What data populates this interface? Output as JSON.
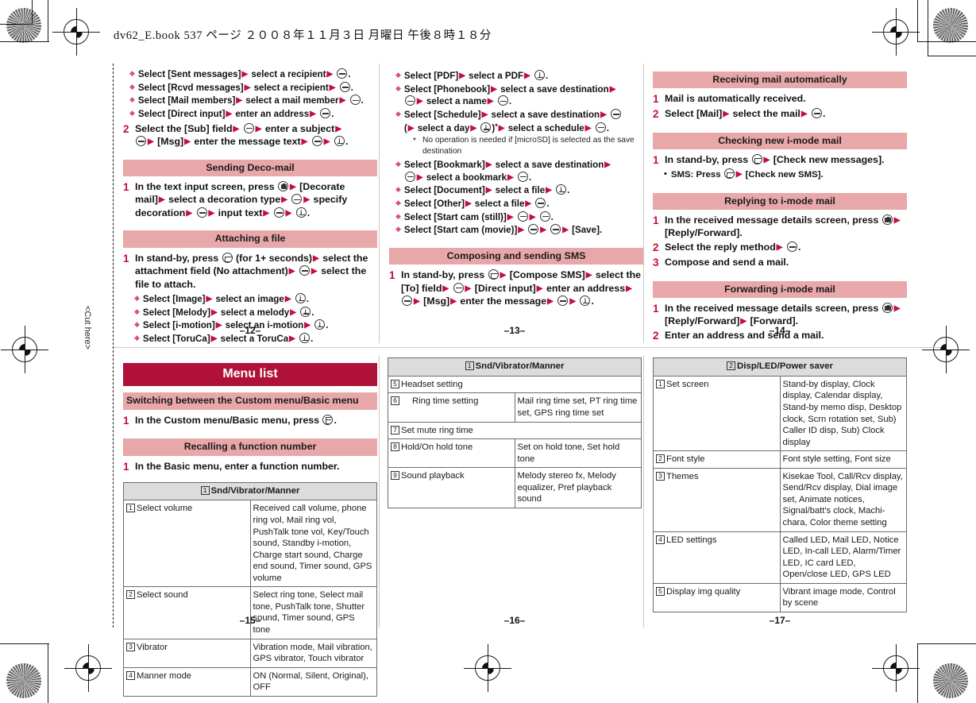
{
  "file_header": "dv62_E.book   537 ページ   ２００８年１１月３日   月曜日   午後８時１８分",
  "cut_here": "<Cut here>",
  "page_numbers": {
    "p12": "–12–",
    "p13": "–13–",
    "p14": "–14–",
    "p15": "–15–",
    "p16": "–16–",
    "p17": "–17–"
  },
  "colors": {
    "section_bar": "#e8a7a9",
    "title_bar": "#b01138",
    "step_number": "#c2103c",
    "arrow": "#c2103c",
    "diamond": "#d4566b",
    "table_header": "#dcdcdc"
  },
  "panel_12": {
    "bullets_top": [
      {
        "pre": "Select [Sent messages]",
        "mid": "select a recipient",
        "keys": [
          "center"
        ],
        "tail": "."
      },
      {
        "pre": "Select [Rcvd messages]",
        "mid": "select a recipient",
        "keys": [
          "center"
        ],
        "tail": "."
      },
      {
        "pre": "Select [Mail members]",
        "mid": "select a mail member",
        "keys": [
          "center"
        ],
        "tail": "."
      },
      {
        "pre": "Select [Direct input]",
        "mid": "enter an address",
        "keys": [
          "center"
        ],
        "tail": "."
      }
    ],
    "step2": "Select the [Sub] field ▶ ⊖ ▶ enter a subject ▶ ⊖ ▶ [Msg] ▶ enter the message text ▶ ⊖ ▶ ⓘ.",
    "sec_deco": "Sending Deco-mail",
    "deco_step1": "In the text input screen, press ⌧ ▶ [Decorate mail] ▶ select a decoration type ▶ ⊖ ▶ specify decoration ▶ ⊖ ▶ input text ▶ ⊖ ▶ ⓘ.",
    "sec_attach": "Attaching a file",
    "attach_step1": "In stand-by, press ✉ (for 1+ seconds) ▶ select the attachment field (No attachment) ▶ ⊖ ▶ select the file to attach.",
    "attach_bullets": [
      {
        "pre": "Select [Image]",
        "mid": "select an image",
        "tail": "."
      },
      {
        "pre": "Select [Melody]",
        "mid": "select a melody",
        "tail": "."
      },
      {
        "pre": "Select [i-motion]",
        "mid": "select an i-motion",
        "tail": "."
      },
      {
        "pre": "Select [ToruCa]",
        "mid": "select a ToruCa",
        "tail": "."
      }
    ]
  },
  "panel_13": {
    "bullets": [
      {
        "text": "Select [PDF] ▶ select a PDF ▶ ⓘ."
      },
      {
        "text": "Select [Phonebook] ▶ select a save destination ▶ ⊖ ▶ select a name ▶ ⊖."
      },
      {
        "text": "Select [Schedule] ▶ select a save destination ▶ ⊖ ( ▶ select a day ▶ ⓘ)* ▶ select a schedule ▶ ⊖."
      },
      {
        "text": "Select [Bookmark] ▶ select a save destination ▶ ⊖ ▶ select a bookmark ▶ ⊖."
      },
      {
        "text": "Select [Document] ▶ select a file ▶ ⓘ."
      },
      {
        "text": "Select [Other] ▶ select a file ▶ ⊖."
      },
      {
        "text": "Select [Start cam (still)] ▶ ⊖ ▶ ⊖."
      },
      {
        "text": "Select [Start cam (movie)] ▶ ⊖ ▶ ⊖ ▶ [Save]."
      }
    ],
    "footnote": "No operation is needed if [microSD] is selected as the save destination",
    "sec_sms": "Composing and sending SMS",
    "sms_step1": "In stand-by, press ✉ ▶ [Compose SMS] ▶ select the [To] field ▶ ⊖ ▶ [Direct input] ▶ enter an address ▶ ⊖ ▶ [Msg] ▶ enter the message ▶ ⊖ ▶ ⓘ."
  },
  "panel_14": {
    "sec_receiving": "Receiving mail automatically",
    "receiving_steps": [
      "Mail is automatically received.",
      "Select [Mail] ▶ select the mail ▶ ⊖."
    ],
    "sec_checking": "Checking new i-mode mail",
    "checking_step1": "In stand-by, press ✉ ▶ [Check new messages].",
    "checking_sub": "SMS: Press ✉ ▶ [Check new SMS].",
    "sec_replying": "Replying to i-mode mail",
    "replying_steps": [
      "In the received message details screen, press ⌧ ▶ [Reply/Forward].",
      "Select the reply method ▶ ⊖.",
      "Compose and send a mail."
    ],
    "sec_forwarding": "Forwarding i-mode mail",
    "forwarding_steps": [
      "In the received message details screen, press ⌧ ▶ [Reply/Forward] ▶ [Forward].",
      "Enter an address and send a mail."
    ]
  },
  "panel_15": {
    "title": "Menu list",
    "sec_switching": "Switching between the Custom menu/Basic menu",
    "switching_step1": "In the Custom menu/Basic menu, press ⊞.",
    "sec_recalling": "Recalling a function number",
    "recalling_step1": "In the Basic menu, enter a function number.",
    "table": {
      "header_num": "1",
      "header_label": "Snd/Vibrator/Manner",
      "rows": [
        {
          "num": "1",
          "label": "Select volume",
          "value": "Received call volume, phone ring vol, Mail ring vol, PushTalk tone vol, Key/Touch sound, Standby i-motion, Charge start sound, Charge end sound, Timer sound, GPS volume"
        },
        {
          "num": "2",
          "label": "Select sound",
          "value": "Select ring tone, Select mail tone, PushTalk tone, Shutter sound, Timer sound, GPS tone"
        },
        {
          "num": "3",
          "label": "Vibrator",
          "value": "Vibration mode, Mail vibration, GPS vibrator, Touch vibrator"
        },
        {
          "num": "4",
          "label": "Manner mode",
          "value": "ON (Normal, Silent, Original), OFF"
        }
      ]
    }
  },
  "panel_16": {
    "table": {
      "header_num": "1",
      "header_label": "Snd/Vibrator/Manner",
      "rows": [
        {
          "num": "5",
          "label": "Headset setting",
          "value": "",
          "span": true
        },
        {
          "num": "6",
          "label": "Ring time setting",
          "value": "Mail ring time set, PT ring time set, GPS ring time set"
        },
        {
          "num": "7",
          "label": "Set mute ring time",
          "value": "",
          "span": true
        },
        {
          "num": "8",
          "label": "Hold/On hold tone",
          "value": "Set on hold tone, Set hold tone"
        },
        {
          "num": "9",
          "label": "Sound playback",
          "value": "Melody stereo fx, Melody equalizer, Pref playback sound"
        }
      ]
    }
  },
  "panel_17": {
    "table": {
      "header_num": "2",
      "header_label": "Disp/LED/Power saver",
      "rows": [
        {
          "num": "1",
          "label": "Set screen",
          "value": "Stand-by display, Clock display, Calendar display, Stand-by memo disp, Desktop clock, Scrn rotation set, Sub) Caller ID disp, Sub) Clock display"
        },
        {
          "num": "2",
          "label": "Font style",
          "value": "Font style setting, Font size"
        },
        {
          "num": "3",
          "label": "Themes",
          "value": "Kisekae Tool, Call/Rcv display, Send/Rcv display, Dial image set, Animate notices, Signal/batt's clock, Machi-chara, Color theme setting"
        },
        {
          "num": "4",
          "label": "LED settings",
          "value": "Called LED, Mail LED, Notice LED, In-call LED, Alarm/Timer LED, IC card LED, Open/close LED, GPS LED"
        },
        {
          "num": "5",
          "label": "Display img quality",
          "value": "Vibrant image mode, Control by scene"
        }
      ]
    }
  }
}
